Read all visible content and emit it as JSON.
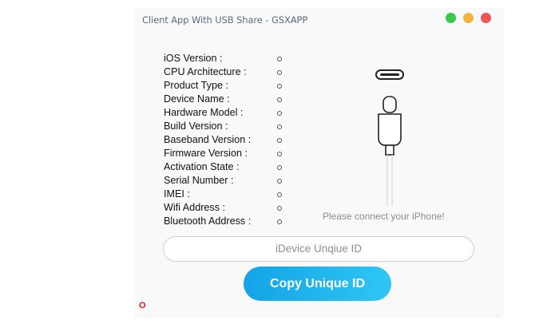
{
  "window": {
    "title": "Client App With USB Share - GSXAPP"
  },
  "device_info": {
    "fields": [
      {
        "label": "iOS Version :",
        "value": ""
      },
      {
        "label": "CPU Architecture :",
        "value": ""
      },
      {
        "label": "Product Type :",
        "value": ""
      },
      {
        "label": "Device Name :",
        "value": ""
      },
      {
        "label": "Hardware Model :",
        "value": ""
      },
      {
        "label": "Build Version :",
        "value": ""
      },
      {
        "label": "Baseband Version :",
        "value": ""
      },
      {
        "label": "Firmware Version :",
        "value": ""
      },
      {
        "label": "Activation State :",
        "value": ""
      },
      {
        "label": "Serial Number :",
        "value": ""
      },
      {
        "label": "IMEI :",
        "value": ""
      },
      {
        "label": "Wifi Address :",
        "value": ""
      },
      {
        "label": "Bluetooth Address :",
        "value": ""
      }
    ]
  },
  "connection": {
    "prompt": "Please connect your iPhone!",
    "icon": "lightning-cable-icon"
  },
  "unique_id": {
    "placeholder": "iDevice Unqiue ID",
    "copy_label": "Copy Unique ID"
  },
  "status_mark": "O",
  "colors": {
    "button_start": "#13a3e8",
    "button_end": "#2fc6f3",
    "close": "#f0545b",
    "minimize": "#f4b43d",
    "maximize": "#38c94a",
    "status_mark": "#e8130f"
  }
}
